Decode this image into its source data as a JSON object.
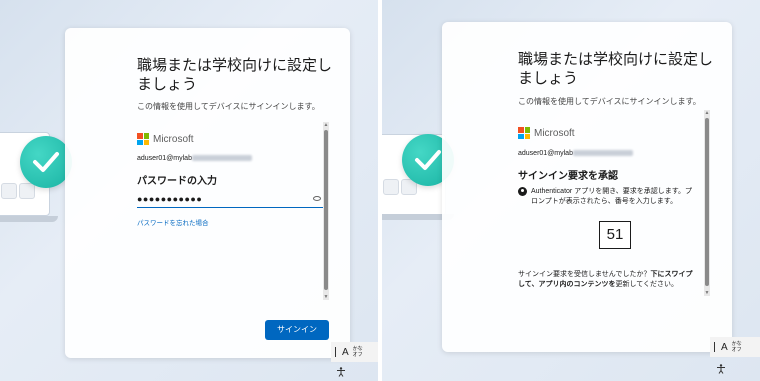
{
  "left_panel": {
    "title": "職場または学校向けに設定しましょう",
    "title_line1": "職場または学校向けに設定し",
    "title_line2": "ましょう",
    "subtitle": "この情報を使用してデバイスにサインインします。",
    "brand": "Microsoft",
    "account_email_prefix": "aduser01@mylab",
    "heading": "パスワードの入力",
    "password_mask": "●●●●●●●●●●●",
    "forgot_password_link": "パスワードを忘れた場合",
    "signin_button": "サインイン"
  },
  "right_panel": {
    "title": "職場または学校向けに設定しましょう",
    "title_line1": "職場または学校向けに設定し",
    "title_line2": "ましょう",
    "subtitle": "この情報を使用してデバイスにサインインします。",
    "brand": "Microsoft",
    "account_email_prefix": "aduser01@mylab",
    "heading": "サインイン要求を承認",
    "auth_instruction_line1": "Authenticator アプリを開き、要求を承認します。プ",
    "auth_instruction_line2": "ロンプトが表示されたら、番号を入力します。",
    "verification_number": "51",
    "prompt_line1_normal": "サインイン要求を受信しませんでしたか？",
    "prompt_line1_bold": "下にスワイプ",
    "prompt_line2_bold": "して、アプリ内のコンテンツを",
    "prompt_line2_normal": "更新してください。"
  },
  "ime": {
    "mode_label": "A",
    "kana_label_top": "かな",
    "kana_label_bottom": "オフ"
  },
  "colors": {
    "accent": "#0067c0",
    "check": "#19b3a3",
    "ms_red": "#f25022",
    "ms_green": "#7fba00",
    "ms_blue": "#00a4ef",
    "ms_yellow": "#ffb900"
  },
  "icons": [
    "check-icon",
    "microsoft-logo-icon",
    "eye-icon",
    "authenticator-icon",
    "accessibility-icon"
  ]
}
